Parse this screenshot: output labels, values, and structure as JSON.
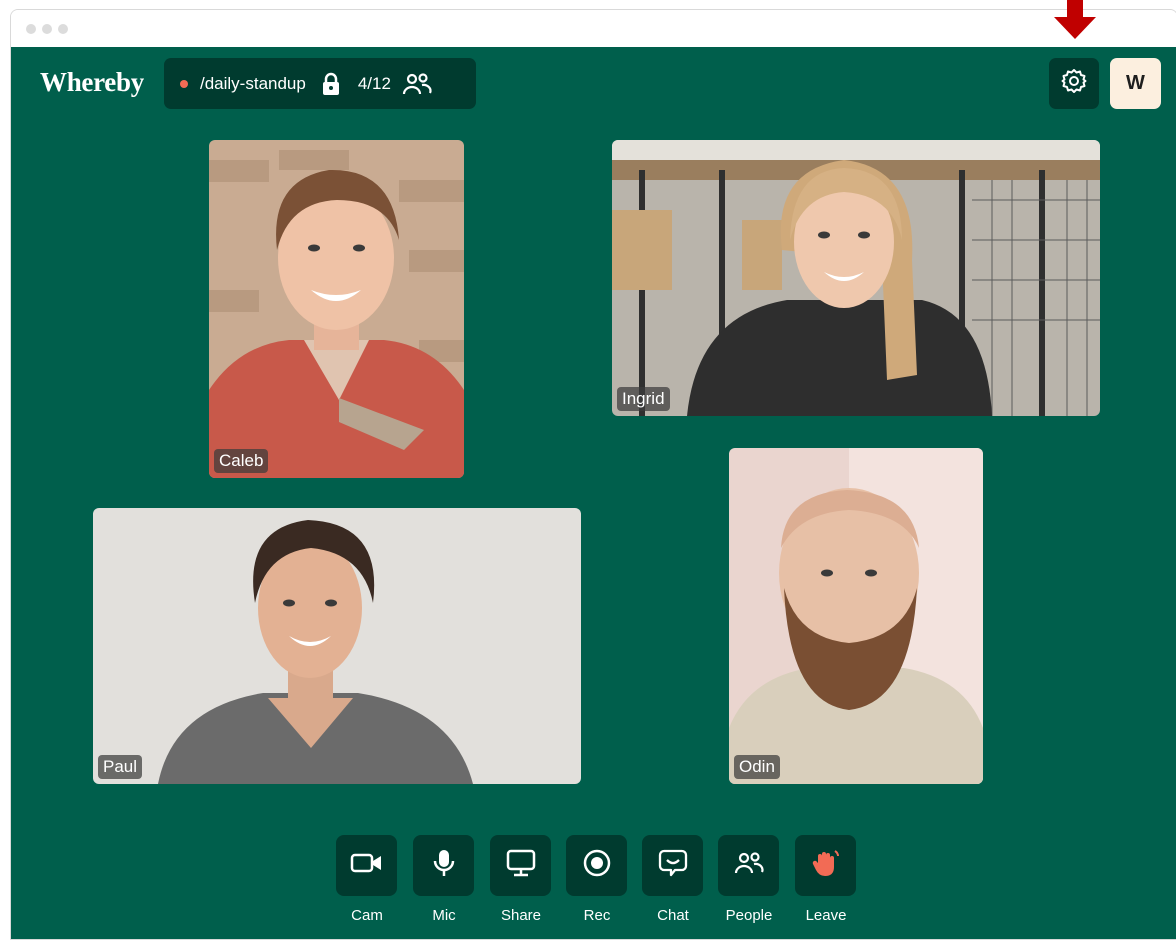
{
  "app": {
    "name": "Whereby"
  },
  "room": {
    "name": "/daily-standup",
    "participant_count": "4/12",
    "locked": true
  },
  "header": {
    "settings_icon": "gear-icon",
    "avatar_initial": "W"
  },
  "participants": [
    {
      "name": "Caleb"
    },
    {
      "name": "Ingrid"
    },
    {
      "name": "Paul"
    },
    {
      "name": "Odin"
    }
  ],
  "controls": [
    {
      "label": "Cam",
      "icon": "camera-icon"
    },
    {
      "label": "Mic",
      "icon": "microphone-icon"
    },
    {
      "label": "Share",
      "icon": "screen-share-icon"
    },
    {
      "label": "Rec",
      "icon": "record-icon"
    },
    {
      "label": "Chat",
      "icon": "chat-icon"
    },
    {
      "label": "People",
      "icon": "people-icon"
    },
    {
      "label": "Leave",
      "icon": "waving-hand-icon"
    }
  ],
  "colors": {
    "background": "#005f4c",
    "panel": "#003b2f",
    "recording_dot": "#f26b55",
    "leave_hand": "#f26b55",
    "avatar_bg": "#fcefdf",
    "annotation_arrow": "#c00000"
  }
}
